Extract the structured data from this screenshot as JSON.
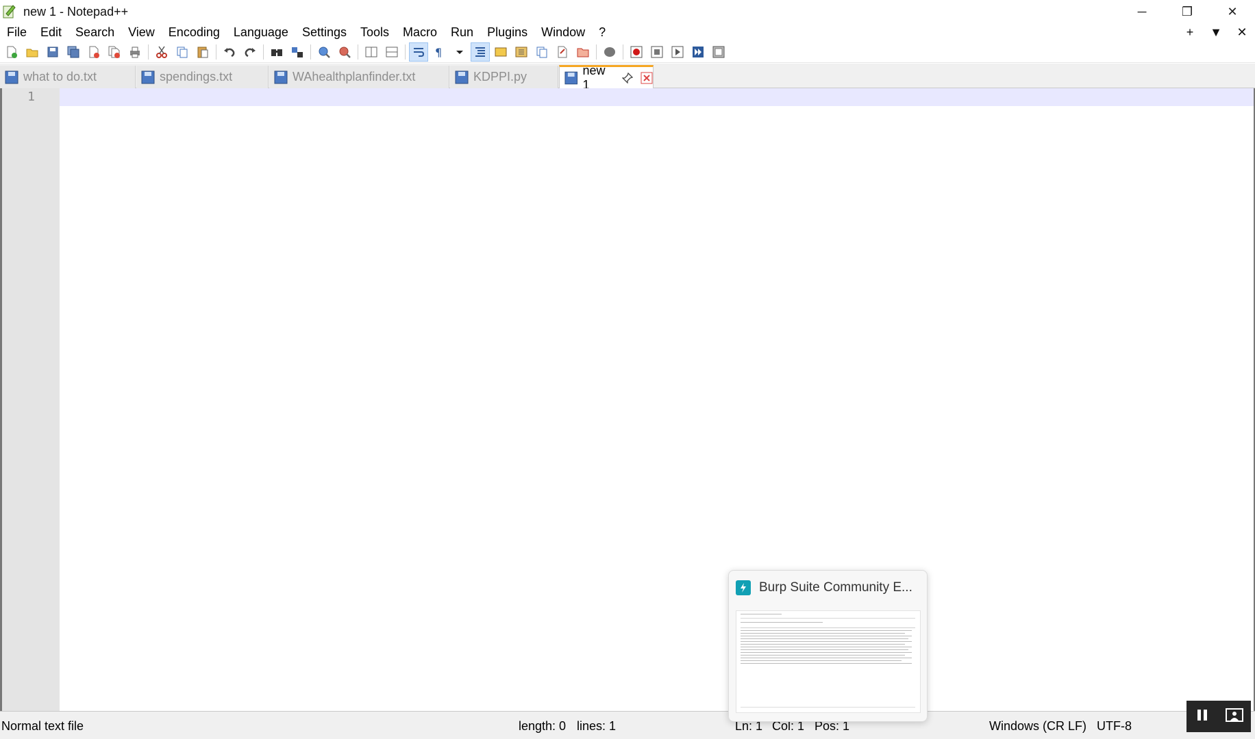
{
  "window": {
    "title": "new 1 - Notepad++",
    "controls": {
      "minimize": "─",
      "restore": "❐",
      "close": "✕"
    }
  },
  "menu": {
    "items": [
      "File",
      "Edit",
      "Search",
      "View",
      "Encoding",
      "Language",
      "Settings",
      "Tools",
      "Macro",
      "Run",
      "Plugins",
      "Window",
      "?"
    ],
    "right": {
      "add": "+",
      "dropdown": "▼",
      "close": "✕"
    }
  },
  "toolbar": {
    "icons": [
      "new-file-icon",
      "open-file-icon",
      "save-icon",
      "save-all-icon",
      "close-icon",
      "close-all-icon",
      "print-icon",
      "cut-icon",
      "copy-icon",
      "paste-icon",
      "undo-icon",
      "redo-icon",
      "find-icon",
      "replace-icon",
      "zoom-in-icon",
      "zoom-out-icon",
      "sync-vertical-icon",
      "sync-horizontal-icon",
      "word-wrap-icon",
      "show-all-characters-icon",
      "indent-guide-icon",
      "doc-map-icon",
      "function-list-icon",
      "folder-as-workspace-icon",
      "doc-list-icon",
      "monitoring-icon",
      "record-macro-icon",
      "stop-macro-icon",
      "play-macro-icon",
      "run-macro-multiple-icon",
      "save-macro-icon"
    ]
  },
  "tabs": [
    {
      "label": "what to do.txt",
      "active": false
    },
    {
      "label": "spendings.txt",
      "active": false
    },
    {
      "label": "WAhealthplanfinder.txt",
      "active": false
    },
    {
      "label": "KDPPI.py",
      "active": false
    },
    {
      "label": "new 1",
      "active": true
    }
  ],
  "editor": {
    "line_numbers": [
      "1"
    ],
    "content": ""
  },
  "status": {
    "file_type": "Normal text file",
    "length": "length: 0",
    "lines": "lines: 1",
    "ln": "Ln: 1",
    "col": "Col: 1",
    "pos": "Pos: 1",
    "eol": "Windows (CR LF)",
    "encoding": "UTF-8"
  },
  "preview": {
    "title": "Burp Suite Community E..."
  },
  "colors": {
    "active_tab_accent": "#f5a623",
    "current_line": "#e8e8ff",
    "gutter": "#e4e4e4",
    "burp_icon": "#11a0b4"
  }
}
